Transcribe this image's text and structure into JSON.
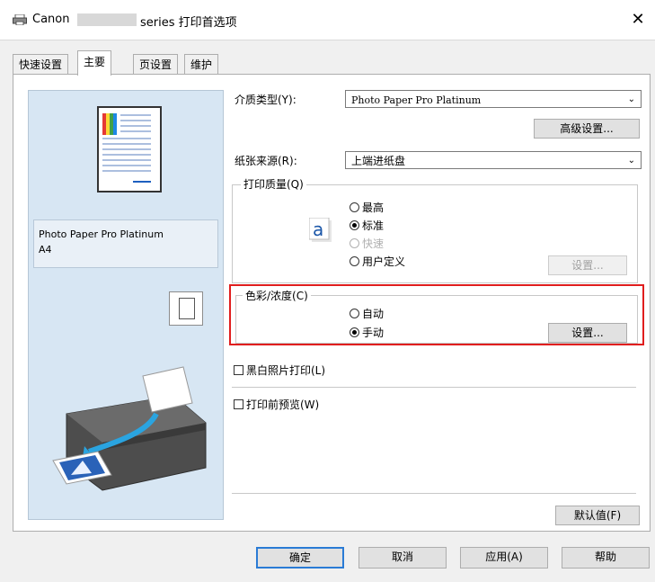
{
  "window": {
    "title_prefix": "Canon",
    "title_suffix": "series 打印首选项",
    "close_symbol": "✕"
  },
  "tabs": [
    {
      "label": "快速设置",
      "active": false
    },
    {
      "label": "主要",
      "active": true
    },
    {
      "label": "页设置",
      "active": false
    },
    {
      "label": "维护",
      "active": false
    }
  ],
  "preview": {
    "media_name": "Photo Paper Pro Platinum",
    "media_size": "A4"
  },
  "media_type": {
    "label": "介质类型(Y):",
    "value": "Photo Paper Pro Platinum",
    "advanced_button": "高级设置..."
  },
  "paper_source": {
    "label": "纸张来源(R):",
    "value": "上端进纸盘"
  },
  "print_quality": {
    "group_label": "打印质量(Q)",
    "options": [
      {
        "label": "最高",
        "selected": false,
        "enabled": true
      },
      {
        "label": "标准",
        "selected": true,
        "enabled": true
      },
      {
        "label": "快速",
        "selected": false,
        "enabled": false
      },
      {
        "label": "用户定义",
        "selected": false,
        "enabled": true
      }
    ],
    "settings_button": "设置..."
  },
  "color_intensity": {
    "group_label": "色彩/浓度(C)",
    "options": [
      {
        "label": "自动",
        "selected": false
      },
      {
        "label": "手动",
        "selected": true
      }
    ],
    "settings_button": "设置..."
  },
  "checkboxes": {
    "grayscale": "黑白照片打印(L)",
    "preview_before": "打印前预览(W)"
  },
  "defaults_button": "默认值(F)",
  "footer": {
    "ok": "确定",
    "cancel": "取消",
    "apply": "应用(A)",
    "help": "帮助"
  },
  "colors": {
    "highlight": "#e01e1e",
    "preview_bg": "#d7e6f3"
  }
}
